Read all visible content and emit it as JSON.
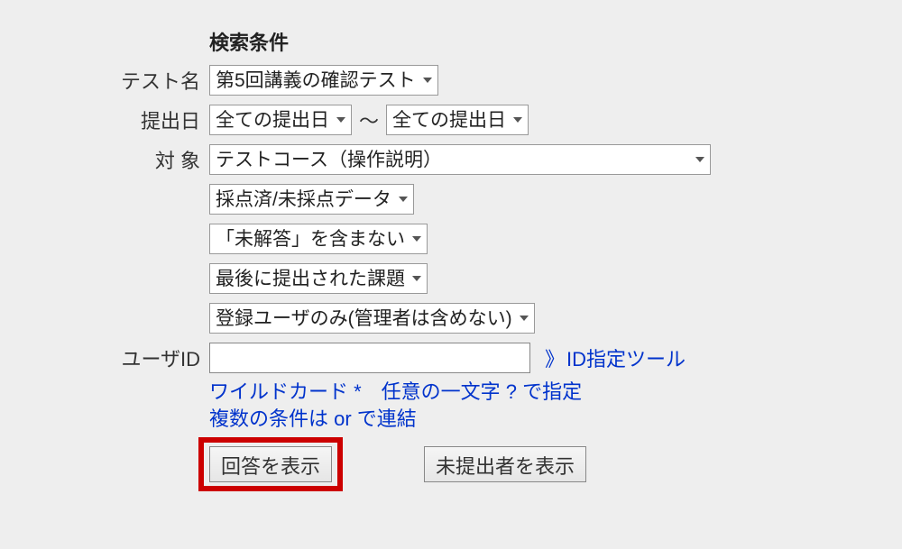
{
  "header": {
    "title": "検索条件"
  },
  "labels": {
    "test_name": "テスト名",
    "submit_date": "提出日",
    "target": "対 象",
    "user_id": "ユーザID"
  },
  "fields": {
    "test_name_value": "第5回講義の確認テスト",
    "submit_date_from": "全ての提出日",
    "submit_date_to": "全ての提出日",
    "date_separator": "～",
    "target_value": "テストコース（操作説明）",
    "grading_status": "採点済/未採点データ",
    "answer_filter": "「未解答」を含まない",
    "submission_filter": "最後に提出された課題",
    "user_filter": "登録ユーザのみ(管理者は含めない)",
    "user_id_value": ""
  },
  "links": {
    "id_tool_arrows": "》",
    "id_tool_label": "ID指定ツール"
  },
  "help": {
    "line1": "ワイルドカード *　任意の一文字 ? で指定",
    "line2": "複数の条件は or で連結"
  },
  "buttons": {
    "show_answers": "回答を表示",
    "show_unsubmitted": "未提出者を表示"
  }
}
